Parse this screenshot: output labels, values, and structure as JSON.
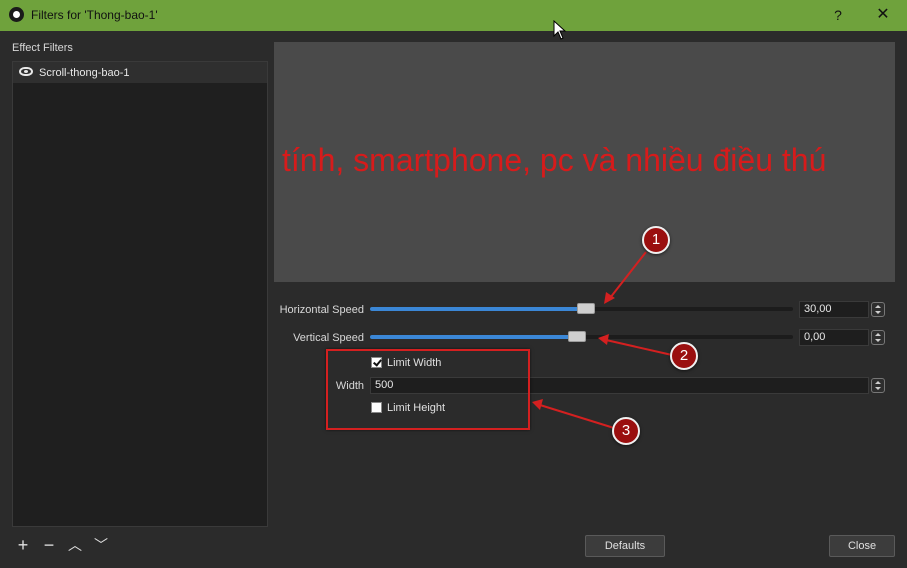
{
  "window": {
    "title": "Filters for 'Thong-bao-1'",
    "help": "?",
    "close": "✕"
  },
  "sidebar": {
    "header": "Effect Filters",
    "filters": [
      {
        "name": "Scroll-thong-bao-1",
        "visible": true
      }
    ],
    "tools": {
      "add": "+",
      "remove": "−",
      "up": "︿",
      "down": "﹀"
    }
  },
  "preview": {
    "text": "tính, smartphone, pc và nhiều điều thú"
  },
  "properties": {
    "horizontal_speed": {
      "label": "Horizontal Speed",
      "value": "30,00",
      "fill": 0.51
    },
    "vertical_speed": {
      "label": "Vertical Speed",
      "value": "0,00",
      "fill": 0.49
    },
    "limit_width": {
      "label": "Limit Width",
      "checked": true
    },
    "width": {
      "label": "Width",
      "value": "500"
    },
    "limit_height": {
      "label": "Limit Height",
      "checked": false
    }
  },
  "annotations": {
    "badge1": "1",
    "badge2": "2",
    "badge3": "3",
    "color": "#d42020"
  },
  "buttons": {
    "defaults": "Defaults",
    "close": "Close"
  },
  "colors": {
    "titlebar": "#6fa23c",
    "accent": "#3b87d6",
    "preview_text": "#d71b1b"
  }
}
